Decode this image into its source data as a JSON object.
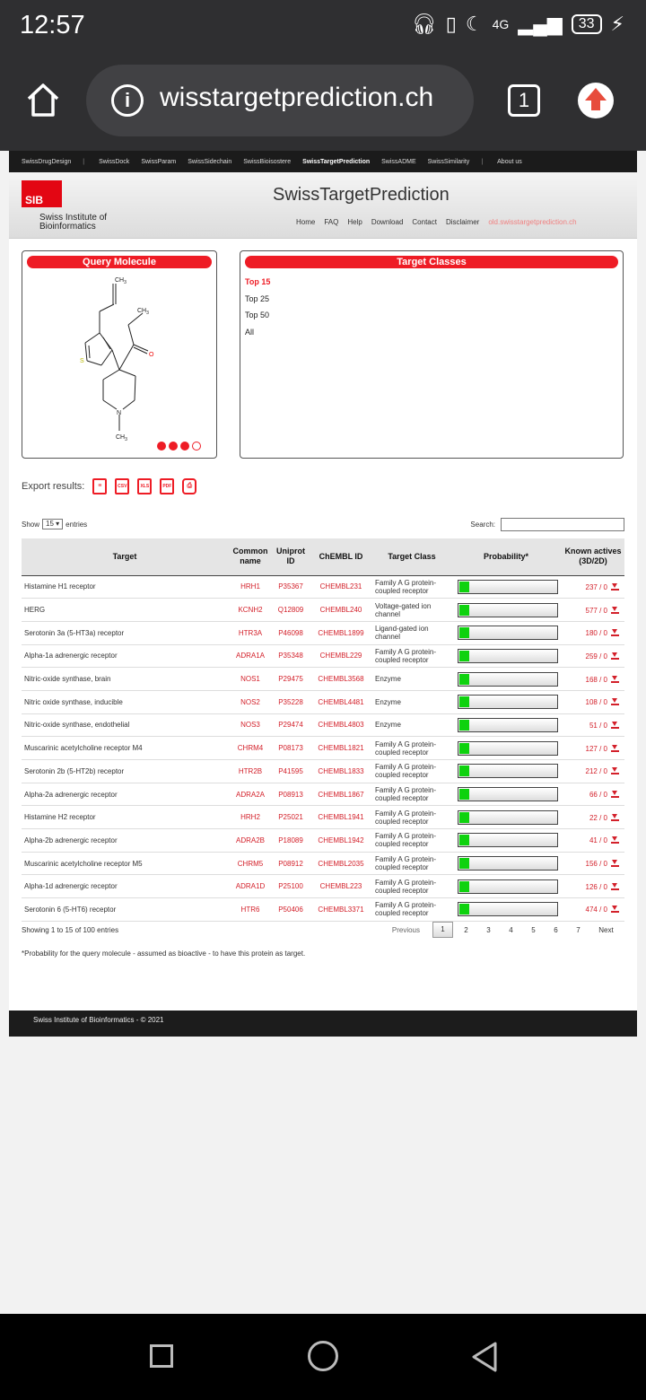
{
  "status": {
    "time": "12:57",
    "network": "4G",
    "battery": "33"
  },
  "browser": {
    "url": "wisstargetprediction.ch",
    "tab_count": "1"
  },
  "topnav": [
    "SwissDrugDesign",
    "SwissDock",
    "SwissParam",
    "SwissSidechain",
    "SwissBioisostere",
    "SwissTargetPrediction",
    "SwissADME",
    "SwissSimilarity",
    "About us"
  ],
  "header": {
    "logo_text": "SIB",
    "org_line1": "Swiss Institute of",
    "org_line2": "Bioinformatics",
    "title": "SwissTargetPrediction",
    "links": [
      "Home",
      "FAQ",
      "Help",
      "Download",
      "Contact",
      "Disclaimer"
    ],
    "old_link": "old.swisstargetprediction.ch"
  },
  "query": {
    "title": "Query Molecule",
    "atoms": {
      "ch3_top": "CH",
      "ch3_right": "CH",
      "s": "S",
      "o": "O",
      "n": "N",
      "ch3_bottom": "CH",
      "sub3": "3"
    }
  },
  "target_classes": {
    "title": "Target Classes",
    "options": [
      "Top 15",
      "Top 25",
      "Top 50",
      "All"
    ]
  },
  "export": {
    "label": "Export results:",
    "formats": [
      "CSV",
      "XLS",
      "PDF"
    ]
  },
  "controls": {
    "show": "Show",
    "entries_value": "15",
    "entries": "entries",
    "search_label": "Search:"
  },
  "table": {
    "headers": {
      "target": "Target",
      "common_name": "Common name",
      "uniprot": "Uniprot ID",
      "chembl": "ChEMBL ID",
      "target_class": "Target Class",
      "probability": "Probability*",
      "known": "Known actives (3D/2D)"
    },
    "rows": [
      {
        "target": "Histamine H1 receptor",
        "common": "HRH1",
        "uniprot": "P35367",
        "chembl": "CHEMBL231",
        "class": "Family A G protein-coupled receptor",
        "prob": 0.1,
        "known": "237 / 0"
      },
      {
        "target": "HERG",
        "common": "KCNH2",
        "uniprot": "Q12809",
        "chembl": "CHEMBL240",
        "class": "Voltage-gated ion channel",
        "prob": 0.1,
        "known": "577 / 0"
      },
      {
        "target": "Serotonin 3a (5-HT3a) receptor",
        "common": "HTR3A",
        "uniprot": "P46098",
        "chembl": "CHEMBL1899",
        "class": "Ligand-gated ion channel",
        "prob": 0.1,
        "known": "180 / 0"
      },
      {
        "target": "Alpha-1a adrenergic receptor",
        "common": "ADRA1A",
        "uniprot": "P35348",
        "chembl": "CHEMBL229",
        "class": "Family A G protein-coupled receptor",
        "prob": 0.1,
        "known": "259 / 0"
      },
      {
        "target": "Nitric-oxide synthase, brain",
        "common": "NOS1",
        "uniprot": "P29475",
        "chembl": "CHEMBL3568",
        "class": "Enzyme",
        "prob": 0.1,
        "known": "168 / 0"
      },
      {
        "target": "Nitric oxide synthase, inducible",
        "common": "NOS2",
        "uniprot": "P35228",
        "chembl": "CHEMBL4481",
        "class": "Enzyme",
        "prob": 0.1,
        "known": "108 / 0"
      },
      {
        "target": "Nitric-oxide synthase, endothelial",
        "common": "NOS3",
        "uniprot": "P29474",
        "chembl": "CHEMBL4803",
        "class": "Enzyme",
        "prob": 0.1,
        "known": "51 / 0"
      },
      {
        "target": "Muscarinic acetylcholine receptor M4",
        "common": "CHRM4",
        "uniprot": "P08173",
        "chembl": "CHEMBL1821",
        "class": "Family A G protein-coupled receptor",
        "prob": 0.1,
        "known": "127 / 0"
      },
      {
        "target": "Serotonin 2b (5-HT2b) receptor",
        "common": "HTR2B",
        "uniprot": "P41595",
        "chembl": "CHEMBL1833",
        "class": "Family A G protein-coupled receptor",
        "prob": 0.1,
        "known": "212 / 0"
      },
      {
        "target": "Alpha-2a adrenergic receptor",
        "common": "ADRA2A",
        "uniprot": "P08913",
        "chembl": "CHEMBL1867",
        "class": "Family A G protein-coupled receptor",
        "prob": 0.1,
        "known": "66 / 0"
      },
      {
        "target": "Histamine H2 receptor",
        "common": "HRH2",
        "uniprot": "P25021",
        "chembl": "CHEMBL1941",
        "class": "Family A G protein-coupled receptor",
        "prob": 0.1,
        "known": "22 / 0"
      },
      {
        "target": "Alpha-2b adrenergic receptor",
        "common": "ADRA2B",
        "uniprot": "P18089",
        "chembl": "CHEMBL1942",
        "class": "Family A G protein-coupled receptor",
        "prob": 0.1,
        "known": "41 / 0"
      },
      {
        "target": "Muscarinic acetylcholine receptor M5",
        "common": "CHRM5",
        "uniprot": "P08912",
        "chembl": "CHEMBL2035",
        "class": "Family A G protein-coupled receptor",
        "prob": 0.1,
        "known": "156 / 0"
      },
      {
        "target": "Alpha-1d adrenergic receptor",
        "common": "ADRA1D",
        "uniprot": "P25100",
        "chembl": "CHEMBL223",
        "class": "Family A G protein-coupled receptor",
        "prob": 0.1,
        "known": "126 / 0"
      },
      {
        "target": "Serotonin 6 (5-HT6) receptor",
        "common": "HTR6",
        "uniprot": "P50406",
        "chembl": "CHEMBL3371",
        "class": "Family A G protein-coupled receptor",
        "prob": 0.1,
        "known": "474 / 0"
      }
    ]
  },
  "pagination": {
    "showing": "Showing 1 to 15 of 100 entries",
    "previous": "Previous",
    "pages": [
      "1",
      "2",
      "3",
      "4",
      "5",
      "6",
      "7"
    ],
    "next": "Next"
  },
  "footnote": "*Probability for the query molecule - assumed as bioactive - to have this protein as target.",
  "footer": "Swiss Institute of Bioinformatics - © 2021",
  "colors": {
    "accent": "#ee1c25",
    "link": "#d3202a",
    "bar": "#0ed20e"
  }
}
